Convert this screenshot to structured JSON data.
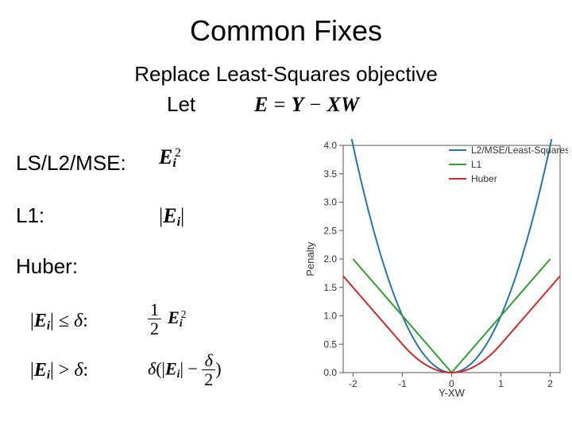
{
  "title": "Common Fixes",
  "subtitle": "Replace Least-Squares objective",
  "let_word": "Let",
  "labels": {
    "ls": "LS/L2/MSE:",
    "l1": "L1:",
    "huber": "Huber:"
  },
  "eq": {
    "let": "E = Y − XW",
    "ls": "E_i^2",
    "l1": "|E_i|",
    "huber_cond1": "|E_i| ≤ δ:",
    "huber_cond2": "|E_i| > δ:",
    "huber_eq1": "(1/2) E_i^2",
    "huber_eq2": "δ(|E_i| − δ/2)"
  },
  "chart_data": {
    "type": "line",
    "title": "",
    "xlabel": "Y-XW",
    "ylabel": "Penalty",
    "xlim": [
      -2.2,
      2.2
    ],
    "ylim": [
      0.0,
      4.0
    ],
    "xticks": [
      -2,
      -1,
      0,
      1,
      2
    ],
    "yticks": [
      0.0,
      0.5,
      1.0,
      1.5,
      2.0,
      2.5,
      3.0,
      3.5,
      4.0
    ],
    "legend_position": "top-right",
    "series": [
      {
        "name": "L2/MSE/Least-Squares",
        "color": "#1f77b4",
        "x": [
          -2.0,
          -1.5,
          -1.0,
          -0.5,
          0.0,
          0.5,
          1.0,
          1.5,
          2.0
        ],
        "y": [
          4.0,
          2.25,
          1.0,
          0.25,
          0.0,
          0.25,
          1.0,
          2.25,
          4.0
        ]
      },
      {
        "name": "L1",
        "color": "#2ca02c",
        "x": [
          -2.0,
          -1.0,
          0.0,
          1.0,
          2.0
        ],
        "y": [
          2.0,
          1.0,
          0.0,
          1.0,
          2.0
        ]
      },
      {
        "name": "Huber",
        "color": "#d62728",
        "x": [
          -2.0,
          -1.0,
          -0.5,
          0.0,
          0.5,
          1.0,
          2.0
        ],
        "y": [
          1.5,
          0.5,
          0.125,
          0.0,
          0.125,
          0.5,
          1.5
        ]
      }
    ]
  }
}
